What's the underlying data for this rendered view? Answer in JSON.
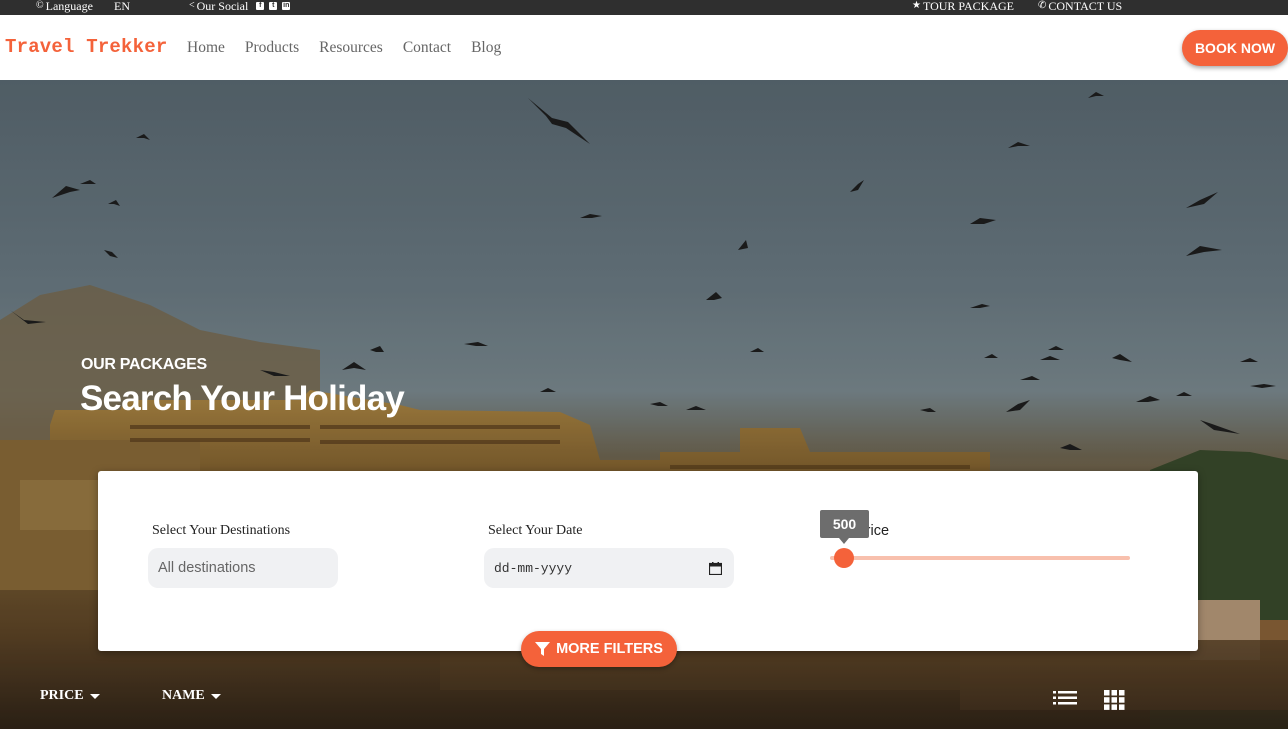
{
  "topbar": {
    "language_label": "Language",
    "language_value": "EN",
    "social_label": "Our Social",
    "social_icons": [
      "facebook-icon",
      "twitter-icon",
      "linkedin-icon"
    ],
    "tour_package": "TOUR PACKAGE",
    "contact_us": "CONTACT US"
  },
  "navbar": {
    "logo": "Travel Trekker",
    "links": [
      "Home",
      "Products",
      "Resources",
      "Contact",
      "Blog"
    ],
    "book_now": "BOOK NOW"
  },
  "hero": {
    "subtitle": "OUR PACKAGES",
    "title": "Search Your Holiday"
  },
  "search": {
    "destination_label": "Select Your Destinations",
    "destination_value": "All destinations",
    "date_label": "Select Your Date",
    "date_placeholder": "dd-mm-yyyy",
    "price_label": "Price",
    "price_value": "500"
  },
  "filters": {
    "more_filters": "MORE FILTERS",
    "sort_price": "PRICE",
    "sort_name": "NAME"
  },
  "colors": {
    "accent": "#f4623a",
    "topbar_bg": "#2f2f2f"
  }
}
